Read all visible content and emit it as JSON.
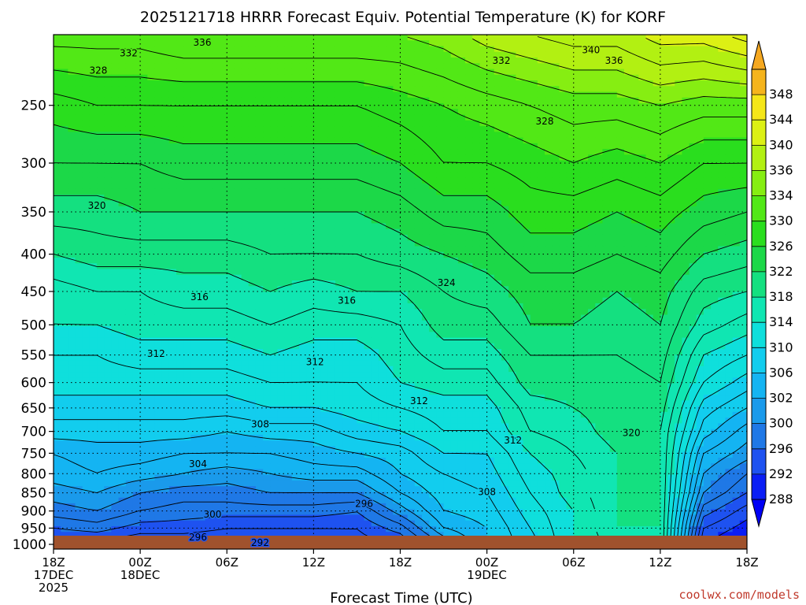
{
  "chart_data": {
    "type": "heatmap",
    "title": "2025121718 HRRR Forecast Equiv. Potential Temperature (K) for KORF",
    "xlabel": "Forecast Time (UTC)",
    "ylabel": "",
    "x_ticks": [
      {
        "hour": 0,
        "lines": [
          "18Z",
          "17DEC",
          "2025"
        ]
      },
      {
        "hour": 6,
        "lines": [
          "00Z",
          "18DEC"
        ]
      },
      {
        "hour": 12,
        "lines": [
          "06Z"
        ]
      },
      {
        "hour": 18,
        "lines": [
          "12Z"
        ]
      },
      {
        "hour": 24,
        "lines": [
          "18Z"
        ]
      },
      {
        "hour": 30,
        "lines": [
          "00Z",
          "19DEC"
        ]
      },
      {
        "hour": 36,
        "lines": [
          "06Z"
        ]
      },
      {
        "hour": 42,
        "lines": [
          "12Z"
        ]
      },
      {
        "hour": 48,
        "lines": [
          "18Z"
        ]
      }
    ],
    "xlim": [
      0,
      48
    ],
    "y_ticks": [
      250,
      300,
      350,
      400,
      450,
      500,
      550,
      600,
      650,
      700,
      750,
      800,
      850,
      900,
      950,
      1000
    ],
    "ylim_hpa": [
      1015,
      200
    ],
    "y_scale": "log",
    "grid": true,
    "colorbar": {
      "levels": [
        288,
        292,
        296,
        300,
        302,
        306,
        310,
        314,
        318,
        322,
        326,
        330,
        334,
        336,
        340,
        344,
        348
      ],
      "colors": [
        "#0a1ef5",
        "#1e52f0",
        "#1f78e6",
        "#1a9aeb",
        "#14b4f2",
        "#12cdee",
        "#0fdfdc",
        "#10e6b2",
        "#14e080",
        "#1cd848",
        "#2ade1e",
        "#52e816",
        "#86ee12",
        "#b2f012",
        "#dcf014",
        "#f5e618",
        "#f5b41c"
      ],
      "over_color": "#f5a820",
      "under_color": "#0000f5"
    },
    "profiles_key": "columns of theta-e (K) sampled by hour; pressures in hPa",
    "profile_pressures": [
      1000,
      950,
      900,
      850,
      800,
      750,
      700,
      650,
      600,
      550,
      500,
      450,
      400,
      350,
      300,
      250,
      200
    ],
    "profiles": [
      {
        "hour": 0,
        "values": [
          293,
          296,
          299,
          301,
          303,
          304,
          307,
          309,
          311,
          312,
          314,
          315,
          318,
          321,
          324,
          327,
          333
        ]
      },
      {
        "hour": 3,
        "values": [
          293,
          297,
          300,
          302,
          304,
          305,
          307,
          309,
          311,
          312,
          314,
          316,
          319,
          321,
          324,
          328,
          333
        ]
      },
      {
        "hour": 6,
        "values": [
          292,
          295,
          298,
          300,
          303,
          305,
          307,
          309,
          311,
          313,
          315,
          316,
          319,
          322,
          324,
          328,
          333
        ]
      },
      {
        "hour": 9,
        "values": [
          292,
          295,
          297,
          299,
          302,
          304,
          307,
          309,
          311,
          313,
          315,
          317,
          319,
          322,
          325,
          328,
          334
        ]
      },
      {
        "hour": 12,
        "values": [
          292,
          294,
          297,
          299,
          301,
          304,
          306,
          309,
          311,
          313,
          315,
          317,
          319,
          322,
          325,
          328,
          334
        ]
      },
      {
        "hour": 15,
        "values": [
          292,
          294,
          297,
          300,
          302,
          304,
          307,
          310,
          312,
          314,
          316,
          318,
          320,
          322,
          325,
          328,
          334
        ]
      },
      {
        "hour": 18,
        "values": [
          292,
          294,
          297,
          300,
          303,
          305,
          307,
          310,
          312,
          313,
          315,
          317,
          320,
          322,
          325,
          328,
          334
        ]
      },
      {
        "hour": 21,
        "values": [
          293,
          294,
          296,
          300,
          303,
          306,
          309,
          311,
          312,
          313,
          315,
          318,
          320,
          322,
          325,
          328,
          334
        ]
      },
      {
        "hour": 24,
        "values": [
          294,
          297,
          301,
          304,
          306,
          307,
          310,
          312,
          314,
          315,
          316,
          318,
          321,
          323,
          326,
          329,
          334
        ]
      },
      {
        "hour": 27,
        "values": [
          300,
          304,
          306,
          307,
          308,
          310,
          312,
          313,
          315,
          317,
          319,
          320,
          322,
          325,
          328,
          330,
          335
        ]
      },
      {
        "hour": 30,
        "values": [
          306,
          306,
          307,
          308,
          309,
          310,
          312,
          313,
          315,
          317,
          319,
          321,
          323,
          325,
          328,
          331,
          337
        ]
      },
      {
        "hour": 33,
        "values": [
          309,
          310,
          311,
          312,
          313,
          314,
          316,
          317,
          319,
          320,
          322,
          323,
          325,
          327,
          329,
          332,
          338
        ]
      },
      {
        "hour": 36,
        "values": [
          314,
          314,
          314,
          315,
          315,
          316,
          317,
          318,
          319,
          320,
          322,
          323,
          325,
          327,
          330,
          333,
          339
        ]
      },
      {
        "hour": 39,
        "values": [
          317,
          318,
          318,
          318,
          318,
          318,
          319,
          319,
          319,
          320,
          321,
          322,
          324,
          326,
          329,
          333,
          339
        ]
      },
      {
        "hour": 42,
        "values": [
          318,
          318,
          318,
          318,
          318,
          318,
          318,
          319,
          320,
          321,
          322,
          323,
          325,
          327,
          330,
          334,
          341
        ]
      },
      {
        "hour": 45,
        "values": [
          292,
          294,
          297,
          300,
          302,
          304,
          307,
          309,
          312,
          314,
          317,
          319,
          322,
          325,
          328,
          333,
          341
        ]
      },
      {
        "hour": 48,
        "values": [
          289,
          291,
          293,
          296,
          298,
          301,
          303,
          306,
          309,
          312,
          315,
          318,
          321,
          324,
          328,
          333,
          343
        ]
      }
    ],
    "contour_labels": [
      {
        "text": "336",
        "hour": 10.3,
        "p": 205
      },
      {
        "text": "332",
        "hour": 5.2,
        "p": 212
      },
      {
        "text": "328",
        "hour": 3.1,
        "p": 224
      },
      {
        "text": "340",
        "hour": 37.2,
        "p": 210
      },
      {
        "text": "336",
        "hour": 38.8,
        "p": 217
      },
      {
        "text": "332",
        "hour": 31.0,
        "p": 217
      },
      {
        "text": "328",
        "hour": 34.0,
        "p": 263
      },
      {
        "text": "320",
        "hour": 3.0,
        "p": 343
      },
      {
        "text": "324",
        "hour": 27.2,
        "p": 438
      },
      {
        "text": "316",
        "hour": 10.1,
        "p": 458
      },
      {
        "text": "316",
        "hour": 20.3,
        "p": 463
      },
      {
        "text": "312",
        "hour": 7.1,
        "p": 548
      },
      {
        "text": "312",
        "hour": 18.1,
        "p": 562
      },
      {
        "text": "312",
        "hour": 25.3,
        "p": 636
      },
      {
        "text": "308",
        "hour": 14.3,
        "p": 684
      },
      {
        "text": "312",
        "hour": 31.8,
        "p": 720
      },
      {
        "text": "320",
        "hour": 40.0,
        "p": 703
      },
      {
        "text": "304",
        "hour": 10.0,
        "p": 776
      },
      {
        "text": "308",
        "hour": 30.0,
        "p": 848
      },
      {
        "text": "296",
        "hour": 21.5,
        "p": 880
      },
      {
        "text": "300",
        "hour": 11.0,
        "p": 910
      },
      {
        "text": "296",
        "hour": 10.0,
        "p": 978
      },
      {
        "text": "292",
        "hour": 14.3,
        "p": 995
      }
    ]
  },
  "credit": "coolwx.com/models"
}
